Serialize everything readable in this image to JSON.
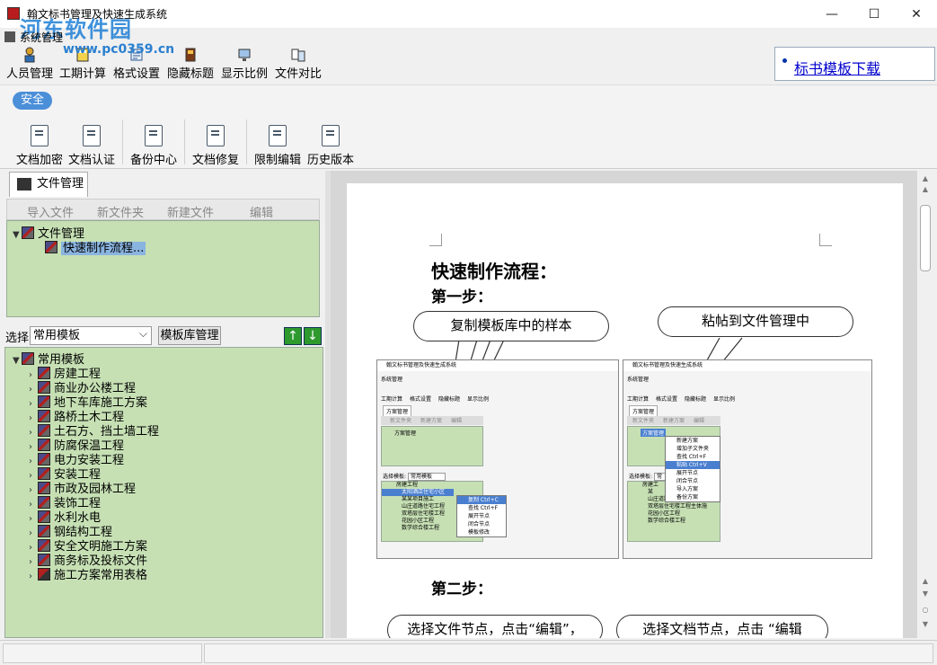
{
  "window": {
    "title": "翰文标书管理及快速生成系统",
    "watermark": "河东软件园",
    "watermark_url": "www.pc0359.cn",
    "minimize": "—",
    "maximize": "☐",
    "close": "✕"
  },
  "menu": {
    "system": "系统管理"
  },
  "top_toolbar": {
    "items": [
      "人员管理",
      "工期计算",
      "格式设置",
      "隐藏标题",
      "显示比例",
      "文件对比"
    ]
  },
  "link_panel": {
    "download_link": "标书模板下载"
  },
  "ribbon": {
    "tab": "安全",
    "buttons": [
      "文档加密",
      "文档认证",
      "备份中心",
      "文档修复",
      "限制编辑",
      "历史版本"
    ]
  },
  "left_panel": {
    "tab_label": "文件管理",
    "toolbar": [
      "导入文件",
      "新文件夹",
      "新建文件",
      "编辑"
    ],
    "file_tree": {
      "root": "文件管理",
      "child": "快速制作流程..."
    },
    "select_label": "选择",
    "select_value": "常用模板",
    "template_manage_button": "模板库管理",
    "up_arrow": "↑",
    "down_arrow": "↓",
    "template_tree": {
      "root": "常用模板",
      "items": [
        "房建工程",
        "商业办公楼工程",
        "地下车库施工方案",
        "路桥土木工程",
        "土石方、挡土墙工程",
        "防腐保温工程",
        "电力安装工程",
        "安装工程",
        "市政及园林工程",
        "装饰工程",
        "水利水电",
        "钢结构工程",
        "安全文明施工方案",
        "商务标及投标文件",
        "施工方案常用表格"
      ]
    }
  },
  "document": {
    "heading": "快速制作流程：",
    "step1": "第一步：",
    "callout1": "复制模板库中的样本",
    "callout2": "粘帖到文件管理中",
    "step2": "第二步：",
    "callout3": "选择文件节点，点击“编辑”，",
    "callout4": "选择文档节点，点击 “编辑",
    "shot_left": {
      "title": "翰文标书管理及快速生成系统",
      "menu": "系统管理",
      "tools": [
        "工期计算",
        "格式设置",
        "隐藏标题",
        "显示比例"
      ],
      "tab": "方案管理",
      "toolbar": [
        "新文件夹",
        "新建方案",
        "编辑"
      ],
      "tree_root": "方案管理",
      "select_label": "选择模板:",
      "select_value": "常用模板",
      "tree_items": [
        "房建工程",
        "太阳酒店住宅小区",
        "某某项目施工",
        "山庄道路住宅工程",
        "双塔层住宅楼工程",
        "花园小区工程",
        "数学综合楼工程"
      ],
      "context_menu": [
        "复制 Ctrl+C",
        "查找 Ctrl+F",
        "展开节点",
        "闭合节点",
        "模板修改"
      ]
    },
    "shot_right": {
      "title": "翰文标书管理及快速生成系统",
      "menu": "系统管理",
      "tools": [
        "工期计算",
        "格式设置",
        "隐藏标题",
        "显示比例"
      ],
      "tab": "方案管理",
      "toolbar": [
        "新文件夹",
        "新建方案",
        "编辑"
      ],
      "tree_root": "方案管理",
      "select_label": "选择模板:",
      "select_value": "常",
      "tree_items": [
        "房建工",
        "某",
        "山庄道路住宅工程",
        "双塔层住宅楼工程主体施",
        "花园小区工程",
        "数学综合楼工程"
      ],
      "context_menu": [
        "新建方案",
        "增加子文件夹",
        "查找 Ctrl+F",
        "粘贴 Ctrl+V",
        "展开节点",
        "闭合节点",
        "导入方案",
        "备份方案"
      ]
    }
  }
}
